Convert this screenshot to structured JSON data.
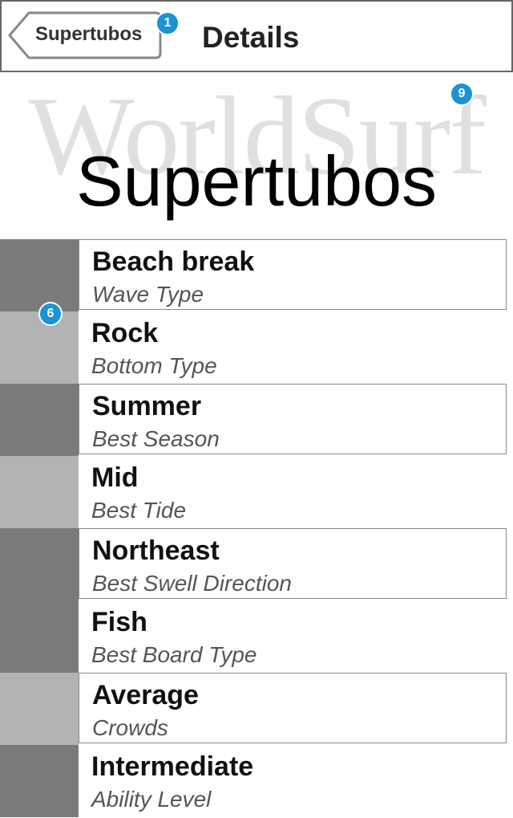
{
  "navbar": {
    "back_label": "Supertubos",
    "title": "Details",
    "back_badge": "1"
  },
  "hero": {
    "watermark": "WorldSurf",
    "spot_name": "Supertubos",
    "badge": "9"
  },
  "list_badge": "6",
  "details": [
    {
      "value": "Beach break",
      "label": "Wave Type"
    },
    {
      "value": "Rock",
      "label": "Bottom Type"
    },
    {
      "value": "Summer",
      "label": "Best Season"
    },
    {
      "value": "Mid",
      "label": "Best Tide"
    },
    {
      "value": "Northeast",
      "label": "Best Swell Direction"
    },
    {
      "value": "Fish",
      "label": "Best Board Type"
    },
    {
      "value": "Average",
      "label": "Crowds"
    },
    {
      "value": "Intermediate",
      "label": "Ability Level"
    }
  ],
  "colors": {
    "swatch_dark": "#7a7a7a",
    "swatch_light": "#b3b3b3",
    "badge": "#1a95d1"
  }
}
